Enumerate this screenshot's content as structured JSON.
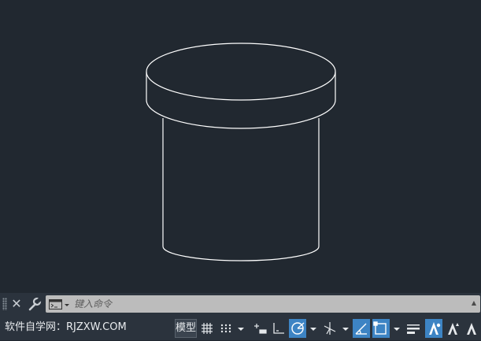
{
  "canvas": {
    "background": "#212830",
    "line_color": "#ffffff"
  },
  "command_line": {
    "placeholder": "键入命令",
    "close_icon_glyph": "✕"
  },
  "status_bar": {
    "watermark": "软件自学网：RJZXW.COM",
    "model_tab_label": "模型",
    "accent_color": "#3d84c4",
    "icons": [
      "grid-icon",
      "snap-icon",
      "infer-constraints-icon",
      "ortho-icon",
      "polar-tracking-icon",
      "isometric-icon",
      "object-snap-tracking-icon",
      "object-snap-icon",
      "lineweight-icon",
      "annotation-scale-icon",
      "annotation-visibility-icon",
      "auto-scale-icon"
    ]
  }
}
